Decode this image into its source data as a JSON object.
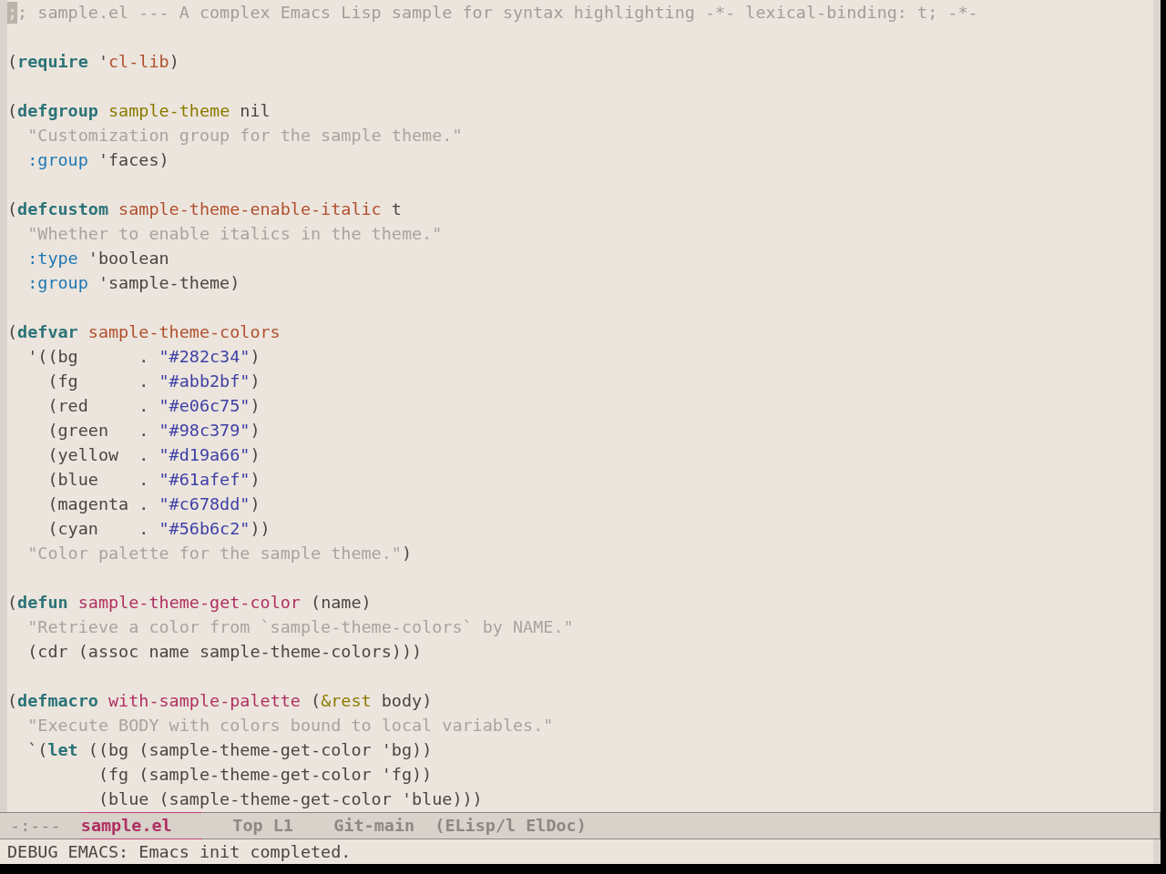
{
  "buffer": {
    "blocks": [
      {
        "lines": [
          {
            "tokens": [
              {
                "text": ";",
                "kind": "cursor"
              },
              {
                "text": "; sample.el --- A complex Emacs Lisp sample for syntax highlighting -*- lexical-binding: t; -*-",
                "kind": "comment"
              }
            ]
          }
        ]
      },
      {
        "lines": [
          {
            "tokens": [
              {
                "text": "(",
                "kind": "plain"
              },
              {
                "text": "require",
                "kind": "keyword"
              },
              {
                "text": " '",
                "kind": "plain"
              },
              {
                "text": "cl-lib",
                "kind": "variable"
              },
              {
                "text": ")",
                "kind": "plain"
              }
            ]
          }
        ]
      },
      {
        "lines": [
          {
            "tokens": [
              {
                "text": "(",
                "kind": "plain"
              },
              {
                "text": "defgroup",
                "kind": "keyword"
              },
              {
                "text": " sample-theme",
                "kind": "type"
              },
              {
                "text": " nil",
                "kind": "plain"
              }
            ]
          },
          {
            "tokens": [
              {
                "text": "  \"Customization group for the sample theme.\"",
                "kind": "doc"
              }
            ]
          },
          {
            "tokens": [
              {
                "text": "  :group",
                "kind": "builtin"
              },
              {
                "text": " 'faces)",
                "kind": "plain"
              }
            ]
          }
        ]
      },
      {
        "lines": [
          {
            "tokens": [
              {
                "text": "(",
                "kind": "plain"
              },
              {
                "text": "defcustom",
                "kind": "keyword"
              },
              {
                "text": " sample-theme-enable-italic",
                "kind": "variable"
              },
              {
                "text": " t",
                "kind": "plain"
              }
            ]
          },
          {
            "tokens": [
              {
                "text": "  \"Whether to enable italics in the theme.\"",
                "kind": "doc"
              }
            ]
          },
          {
            "tokens": [
              {
                "text": "  :type",
                "kind": "builtin"
              },
              {
                "text": " 'boolean",
                "kind": "plain"
              }
            ]
          },
          {
            "tokens": [
              {
                "text": "  :group",
                "kind": "builtin"
              },
              {
                "text": " 'sample-theme)",
                "kind": "plain"
              }
            ]
          }
        ]
      },
      {
        "lines": [
          {
            "tokens": [
              {
                "text": "(",
                "kind": "plain"
              },
              {
                "text": "defvar",
                "kind": "keyword"
              },
              {
                "text": " sample-theme-colors",
                "kind": "variable"
              }
            ]
          },
          {
            "tokens": [
              {
                "text": "  '((bg      . ",
                "kind": "plain"
              },
              {
                "text": "\"#282c34\"",
                "kind": "string"
              },
              {
                "text": ")",
                "kind": "plain"
              }
            ]
          },
          {
            "tokens": [
              {
                "text": "    (fg      . ",
                "kind": "plain"
              },
              {
                "text": "\"#abb2bf\"",
                "kind": "string"
              },
              {
                "text": ")",
                "kind": "plain"
              }
            ]
          },
          {
            "tokens": [
              {
                "text": "    (red     . ",
                "kind": "plain"
              },
              {
                "text": "\"#e06c75\"",
                "kind": "string"
              },
              {
                "text": ")",
                "kind": "plain"
              }
            ]
          },
          {
            "tokens": [
              {
                "text": "    (green   . ",
                "kind": "plain"
              },
              {
                "text": "\"#98c379\"",
                "kind": "string"
              },
              {
                "text": ")",
                "kind": "plain"
              }
            ]
          },
          {
            "tokens": [
              {
                "text": "    (yellow  . ",
                "kind": "plain"
              },
              {
                "text": "\"#d19a66\"",
                "kind": "string"
              },
              {
                "text": ")",
                "kind": "plain"
              }
            ]
          },
          {
            "tokens": [
              {
                "text": "    (blue    . ",
                "kind": "plain"
              },
              {
                "text": "\"#61afef\"",
                "kind": "string"
              },
              {
                "text": ")",
                "kind": "plain"
              }
            ]
          },
          {
            "tokens": [
              {
                "text": "    (magenta . ",
                "kind": "plain"
              },
              {
                "text": "\"#c678dd\"",
                "kind": "string"
              },
              {
                "text": ")",
                "kind": "plain"
              }
            ]
          },
          {
            "tokens": [
              {
                "text": "    (cyan    . ",
                "kind": "plain"
              },
              {
                "text": "\"#56b6c2\"",
                "kind": "string"
              },
              {
                "text": "))",
                "kind": "plain"
              }
            ]
          },
          {
            "tokens": [
              {
                "text": "  \"Color palette for the sample theme.\"",
                "kind": "doc"
              },
              {
                "text": ")",
                "kind": "plain"
              }
            ]
          }
        ]
      },
      {
        "lines": [
          {
            "tokens": [
              {
                "text": "(",
                "kind": "plain"
              },
              {
                "text": "defun",
                "kind": "keyword"
              },
              {
                "text": " sample-theme-get-color",
                "kind": "function"
              },
              {
                "text": " (name)",
                "kind": "plain"
              }
            ]
          },
          {
            "tokens": [
              {
                "text": "  \"Retrieve a color from `sample-theme-colors` by NAME.\"",
                "kind": "doc"
              }
            ]
          },
          {
            "tokens": [
              {
                "text": "  (cdr (assoc name sample-theme-colors)))",
                "kind": "plain"
              }
            ]
          }
        ]
      },
      {
        "lines": [
          {
            "tokens": [
              {
                "text": "(",
                "kind": "plain"
              },
              {
                "text": "defmacro",
                "kind": "keyword"
              },
              {
                "text": " with-sample-palette",
                "kind": "function"
              },
              {
                "text": " (",
                "kind": "plain"
              },
              {
                "text": "&rest",
                "kind": "type"
              },
              {
                "text": " body)",
                "kind": "plain"
              }
            ]
          },
          {
            "tokens": [
              {
                "text": "  \"Execute BODY with colors bound to local variables.\"",
                "kind": "doc"
              }
            ]
          },
          {
            "tokens": [
              {
                "text": "  `(",
                "kind": "plain"
              },
              {
                "text": "let",
                "kind": "keyword"
              },
              {
                "text": " ((bg (sample-theme-get-color 'bg))",
                "kind": "plain"
              }
            ]
          },
          {
            "tokens": [
              {
                "text": "         (fg (sample-theme-get-color 'fg))",
                "kind": "plain"
              }
            ]
          },
          {
            "tokens": [
              {
                "text": "         (blue (sample-theme-get-color 'blue)))",
                "kind": "plain"
              }
            ]
          }
        ]
      }
    ]
  },
  "mode_line": {
    "status": "-:---",
    "buffer_name": "sample.el",
    "position": "Top L1",
    "vc_branch": "Git-main",
    "modes": "(ELisp/l ElDoc)"
  },
  "echo_area": {
    "message": "DEBUG EMACS: Emacs init completed."
  }
}
